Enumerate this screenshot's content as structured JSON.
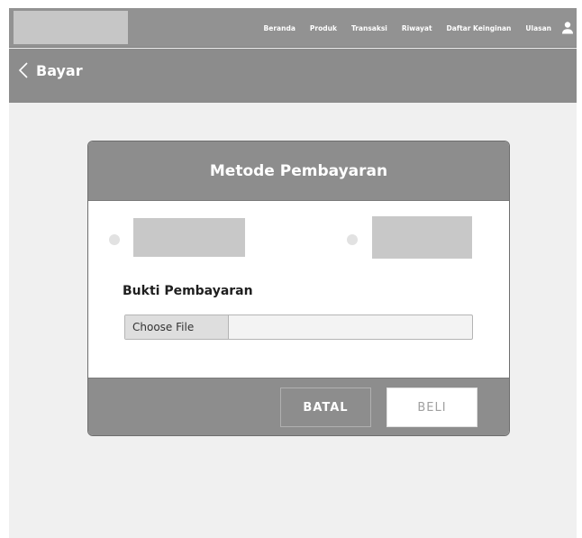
{
  "nav": {
    "links": [
      "Beranda",
      "Produk",
      "Transaksi",
      "Riwayat",
      "Daftar Keinginan",
      "Ulasan"
    ],
    "user_icon": "user-icon"
  },
  "subheader": {
    "back_label": "Bayar",
    "back_icon": "chevron-left-icon"
  },
  "dialog": {
    "title": "Metode Pembayaran",
    "proof_label": "Bukti Pembayaran",
    "file_button_label": "Choose File",
    "cancel_label": "BATAL",
    "buy_label": "BELI"
  },
  "colors": {
    "header_bg": "#929292",
    "dialog_header_bg": "#8d8d8d",
    "page_bg": "#f0f0f0",
    "placeholder": "#c8c8c8"
  }
}
